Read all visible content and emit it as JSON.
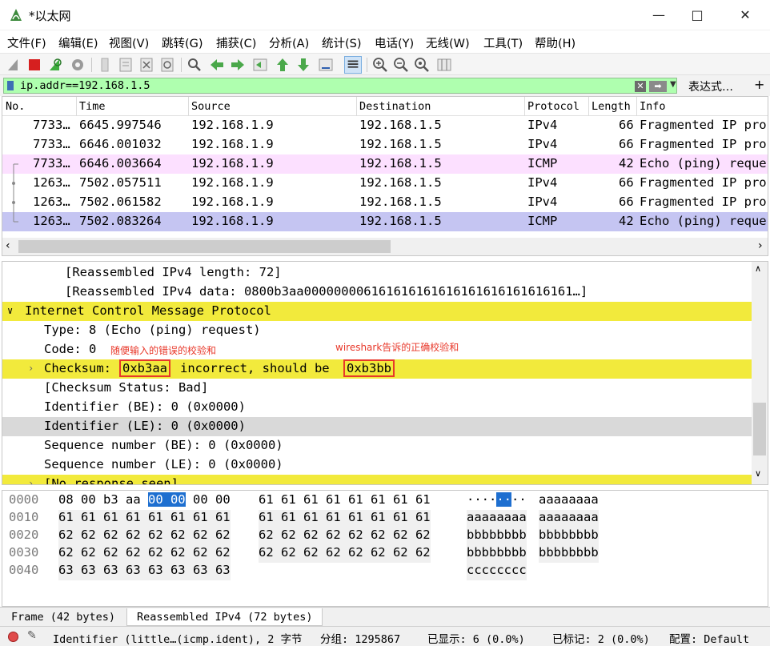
{
  "window": {
    "title": "*以太网"
  },
  "menu": [
    "文件(F)",
    "编辑(E)",
    "视图(V)",
    "跳转(G)",
    "捕获(C)",
    "分析(A)",
    "统计(S)",
    "电话(Y)",
    "无线(W)",
    "工具(T)",
    "帮助(H)"
  ],
  "filter": {
    "value": "ip.addr==192.168.1.5",
    "expression_label": "表达式…",
    "add_label": "+"
  },
  "packet_list": {
    "columns": [
      "No.",
      "Time",
      "Source",
      "Destination",
      "Protocol",
      "Length",
      "Info"
    ],
    "rows": [
      {
        "no": "7733…",
        "time": "6645.997546",
        "source": "192.168.1.9",
        "destination": "192.168.1.5",
        "protocol": "IPv4",
        "length": "66",
        "info": "Fragmented IP pro"
      },
      {
        "no": "7733…",
        "time": "6646.001032",
        "source": "192.168.1.9",
        "destination": "192.168.1.5",
        "protocol": "IPv4",
        "length": "66",
        "info": "Fragmented IP pro"
      },
      {
        "no": "7733…",
        "time": "6646.003664",
        "source": "192.168.1.9",
        "destination": "192.168.1.5",
        "protocol": "ICMP",
        "length": "42",
        "info": "Echo (ping) reque"
      },
      {
        "no": "1263…",
        "time": "7502.057511",
        "source": "192.168.1.9",
        "destination": "192.168.1.5",
        "protocol": "IPv4",
        "length": "66",
        "info": "Fragmented IP pro"
      },
      {
        "no": "1263…",
        "time": "7502.061582",
        "source": "192.168.1.9",
        "destination": "192.168.1.5",
        "protocol": "IPv4",
        "length": "66",
        "info": "Fragmented IP pro"
      },
      {
        "no": "1263…",
        "time": "7502.083264",
        "source": "192.168.1.9",
        "destination": "192.168.1.5",
        "protocol": "ICMP",
        "length": "42",
        "info": "Echo (ping) reque"
      }
    ],
    "row_colors": [
      "#ffffff",
      "#ffffff",
      "#fce0ff",
      "#ffffff",
      "#ffffff",
      "#c5c5f2"
    ]
  },
  "details": {
    "reassembled_length": "[Reassembled IPv4 length: 72]",
    "reassembled_data": "[Reassembled IPv4 data: 0800b3aa000000006161616161616161616161616161…]",
    "icmp_header": "Internet Control Message Protocol",
    "type": "Type: 8 (Echo (ping) request)",
    "code": "Code: 0",
    "annotation_left": "随便输入的错误的校验和",
    "annotation_right": "wireshark告诉的正确校验和",
    "checksum_label": "Checksum:",
    "checksum_wrong": "0xb3aa",
    "checksum_mid": "incorrect, should be",
    "checksum_right": "0xb3bb",
    "checksum_status": "[Checksum Status: Bad]",
    "identifier_be": "Identifier (BE): 0 (0x0000)",
    "identifier_le": "Identifier (LE): 0 (0x0000)",
    "sequence_be": "Sequence number (BE): 0 (0x0000)",
    "sequence_le": "Sequence number (LE): 0 (0x0000)",
    "no_response": "[No response seen]"
  },
  "bytes": {
    "rows": [
      {
        "offset": "0000",
        "hex_a_pre": "08 00 b3 aa ",
        "hex_a_sel": "00 00",
        "hex_a_post": " 00 00",
        "hex_b": "61 61 61 61 61 61 61 61",
        "ascii_a_pre": "····",
        "ascii_a_sel": "··",
        "ascii_a_post": "··",
        "ascii_b": "aaaaaaaa"
      },
      {
        "offset": "0010",
        "hex_a": "61 61 61 61 61 61 61 61",
        "hex_b": "61 61 61 61 61 61 61 61",
        "ascii_a": "aaaaaaaa",
        "ascii_b": "aaaaaaaa"
      },
      {
        "offset": "0020",
        "hex_a": "62 62 62 62 62 62 62 62",
        "hex_b": "62 62 62 62 62 62 62 62",
        "ascii_a": "bbbbbbbb",
        "ascii_b": "bbbbbbbb"
      },
      {
        "offset": "0030",
        "hex_a": "62 62 62 62 62 62 62 62",
        "hex_b": "62 62 62 62 62 62 62 62",
        "ascii_a": "bbbbbbbb",
        "ascii_b": "bbbbbbbb"
      },
      {
        "offset": "0040",
        "hex_a": "63 63 63 63 63 63 63 63",
        "hex_b": "",
        "ascii_a": "cccccccc",
        "ascii_b": ""
      }
    ],
    "tabs": [
      "Frame (42 bytes)",
      "Reassembled IPv4 (72 bytes)"
    ]
  },
  "status": {
    "field": "Identifier (little…(icmp.ident), 2 字节",
    "packets": "分组: 1295867",
    "displayed": "已显示: 6 (0.0%)",
    "marked": "已标记: 2 (0.0%)",
    "profile": "配置: Default"
  },
  "colors": {
    "accent_green": "#afffaf",
    "detail_highlight": "#f2ea3c",
    "annotation_red": "#e8382a",
    "selection_blue": "#1e6fd0"
  },
  "icons": [
    "shark-fin-start-icon",
    "stop-icon",
    "restart-icon",
    "options-gear-icon",
    "open-file-icon",
    "save-file-icon",
    "close-file-icon",
    "reload-icon",
    "find-icon",
    "go-back-icon",
    "go-forward-icon",
    "go-to-packet-icon",
    "first-packet-icon",
    "last-packet-icon",
    "autoscroll-icon",
    "colorize-icon",
    "zoom-in-icon",
    "zoom-out-icon",
    "zoom-reset-icon",
    "resize-columns-icon"
  ]
}
